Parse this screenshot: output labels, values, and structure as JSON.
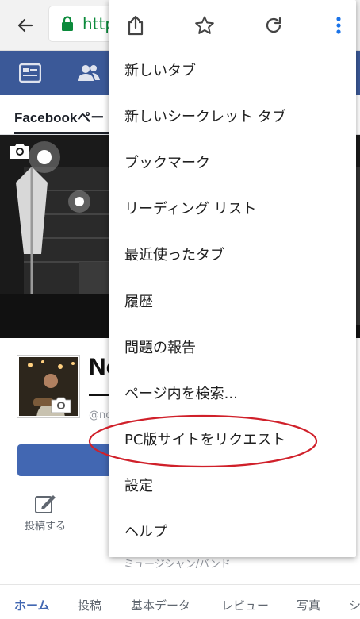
{
  "browser": {
    "url": "http",
    "accent_color": "#0b8a3b"
  },
  "facebook": {
    "nav_color": "#3b5998",
    "page_tab_label": "Facebookペー",
    "profile_name_partial": "No",
    "handle_partial": "@no",
    "post_action_label": "投稿する",
    "category_label": "ミュージシャン/バンド",
    "bottom_tabs": [
      "ホーム",
      "投稿",
      "基本データ",
      "レビュー",
      "写真",
      "シ"
    ],
    "active_tab": "ホーム",
    "active_color": "#4267b2"
  },
  "menu": {
    "header_icons": [
      "share-icon",
      "star-icon",
      "reload-icon",
      "more-vert-icon"
    ],
    "items": [
      "新しいタブ",
      "新しいシークレット タブ",
      "ブックマーク",
      "リーディング リスト",
      "最近使ったタブ",
      "履歴",
      "問題の報告",
      "ページ内を検索...",
      "PC版サイトをリクエスト",
      "設定",
      "ヘルプ"
    ],
    "highlighted_item": "PC版サイトをリクエスト",
    "highlight_color": "#d0202a"
  }
}
